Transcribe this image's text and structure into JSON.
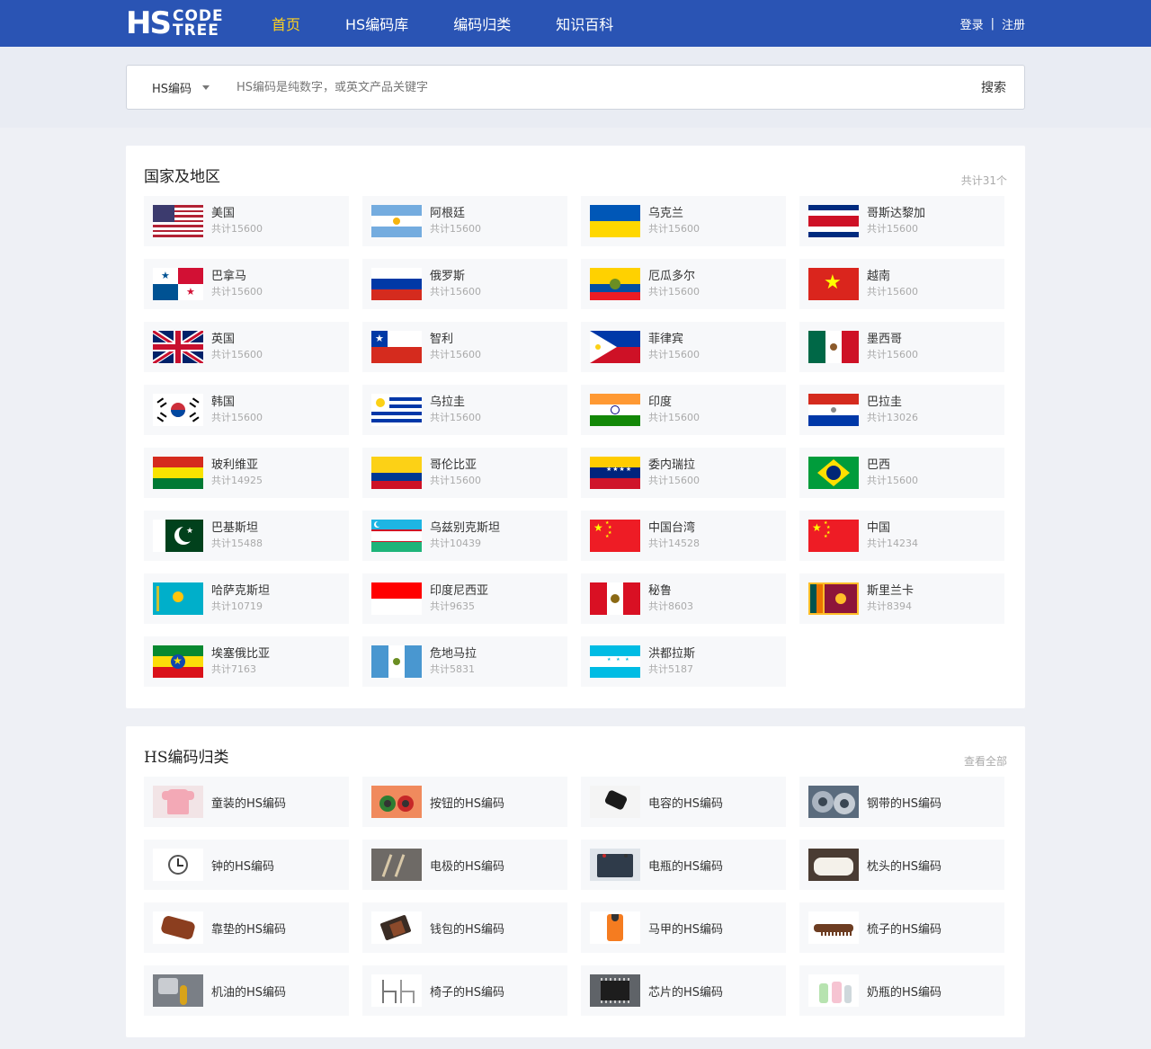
{
  "header": {
    "logo_big": "HS",
    "logo_small_1": "CODE",
    "logo_small_2": "TREE",
    "nav": [
      {
        "label": "首页",
        "active": true
      },
      {
        "label": "HS编码库",
        "active": false
      },
      {
        "label": "编码归类",
        "active": false
      },
      {
        "label": "知识百科",
        "active": false
      }
    ],
    "login": "登录",
    "separator": "|",
    "register": "注册"
  },
  "search": {
    "type_label": "HS编码",
    "placeholder": "HS编码是纯数字，或英文产品关键字",
    "button": "搜索"
  },
  "countries": {
    "title": "国家及地区",
    "total": "共计31个",
    "items": [
      {
        "name": "美国",
        "count": "共计15600",
        "flag": "usa"
      },
      {
        "name": "阿根廷",
        "count": "共计15600",
        "flag": "argentina"
      },
      {
        "name": "乌克兰",
        "count": "共计15600",
        "flag": "ukraine"
      },
      {
        "name": "哥斯达黎加",
        "count": "共计15600",
        "flag": "costarica"
      },
      {
        "name": "巴拿马",
        "count": "共计15600",
        "flag": "panama"
      },
      {
        "name": "俄罗斯",
        "count": "共计15600",
        "flag": "russia"
      },
      {
        "name": "厄瓜多尔",
        "count": "共计15600",
        "flag": "ecuador"
      },
      {
        "name": "越南",
        "count": "共计15600",
        "flag": "vietnam"
      },
      {
        "name": "英国",
        "count": "共计15600",
        "flag": "uk"
      },
      {
        "name": "智利",
        "count": "共计15600",
        "flag": "chile"
      },
      {
        "name": "菲律宾",
        "count": "共计15600",
        "flag": "philippines"
      },
      {
        "name": "墨西哥",
        "count": "共计15600",
        "flag": "mexico"
      },
      {
        "name": "韩国",
        "count": "共计15600",
        "flag": "korea"
      },
      {
        "name": "乌拉圭",
        "count": "共计15600",
        "flag": "uruguay"
      },
      {
        "name": "印度",
        "count": "共计15600",
        "flag": "india"
      },
      {
        "name": "巴拉圭",
        "count": "共计13026",
        "flag": "paraguay"
      },
      {
        "name": "玻利维亚",
        "count": "共计14925",
        "flag": "bolivia"
      },
      {
        "name": "哥伦比亚",
        "count": "共计15600",
        "flag": "colombia"
      },
      {
        "name": "委内瑞拉",
        "count": "共计15600",
        "flag": "venezuela"
      },
      {
        "name": "巴西",
        "count": "共计15600",
        "flag": "brazil"
      },
      {
        "name": "巴基斯坦",
        "count": "共计15488",
        "flag": "pakistan"
      },
      {
        "name": "乌兹别克斯坦",
        "count": "共计10439",
        "flag": "uzbekistan"
      },
      {
        "name": "中国台湾",
        "count": "共计14528",
        "flag": "china"
      },
      {
        "name": "中国",
        "count": "共计14234",
        "flag": "china"
      },
      {
        "name": "哈萨克斯坦",
        "count": "共计10719",
        "flag": "kazakhstan"
      },
      {
        "name": "印度尼西亚",
        "count": "共计9635",
        "flag": "indonesia"
      },
      {
        "name": "秘鲁",
        "count": "共计8603",
        "flag": "peru"
      },
      {
        "name": "斯里兰卡",
        "count": "共计8394",
        "flag": "srilanka"
      },
      {
        "name": "埃塞俄比亚",
        "count": "共计7163",
        "flag": "ethiopia"
      },
      {
        "name": "危地马拉",
        "count": "共计5831",
        "flag": "guatemala"
      },
      {
        "name": "洪都拉斯",
        "count": "共计5187",
        "flag": "honduras"
      }
    ]
  },
  "hs": {
    "title": "HS编码归类",
    "view_all": "查看全部",
    "items": [
      {
        "name": "童装的HS编码",
        "icon": "kids-clothing-icon"
      },
      {
        "name": "按钮的HS编码",
        "icon": "buttons-icon"
      },
      {
        "name": "电容的HS编码",
        "icon": "capacitor-icon"
      },
      {
        "name": "钢带的HS编码",
        "icon": "steel-strip-icon"
      },
      {
        "name": "钟的HS编码",
        "icon": "clock-icon"
      },
      {
        "name": "电极的HS编码",
        "icon": "electrode-icon"
      },
      {
        "name": "电瓶的HS编码",
        "icon": "battery-icon"
      },
      {
        "name": "枕头的HS编码",
        "icon": "pillow-icon"
      },
      {
        "name": "靠垫的HS编码",
        "icon": "cushion-icon"
      },
      {
        "name": "钱包的HS编码",
        "icon": "wallet-icon"
      },
      {
        "name": "马甲的HS编码",
        "icon": "vest-icon"
      },
      {
        "name": "梳子的HS编码",
        "icon": "comb-icon"
      },
      {
        "name": "机油的HS编码",
        "icon": "motor-oil-icon"
      },
      {
        "name": "椅子的HS编码",
        "icon": "chair-icon"
      },
      {
        "name": "芯片的HS编码",
        "icon": "chip-icon"
      },
      {
        "name": "奶瓶的HS编码",
        "icon": "baby-bottle-icon"
      }
    ]
  }
}
